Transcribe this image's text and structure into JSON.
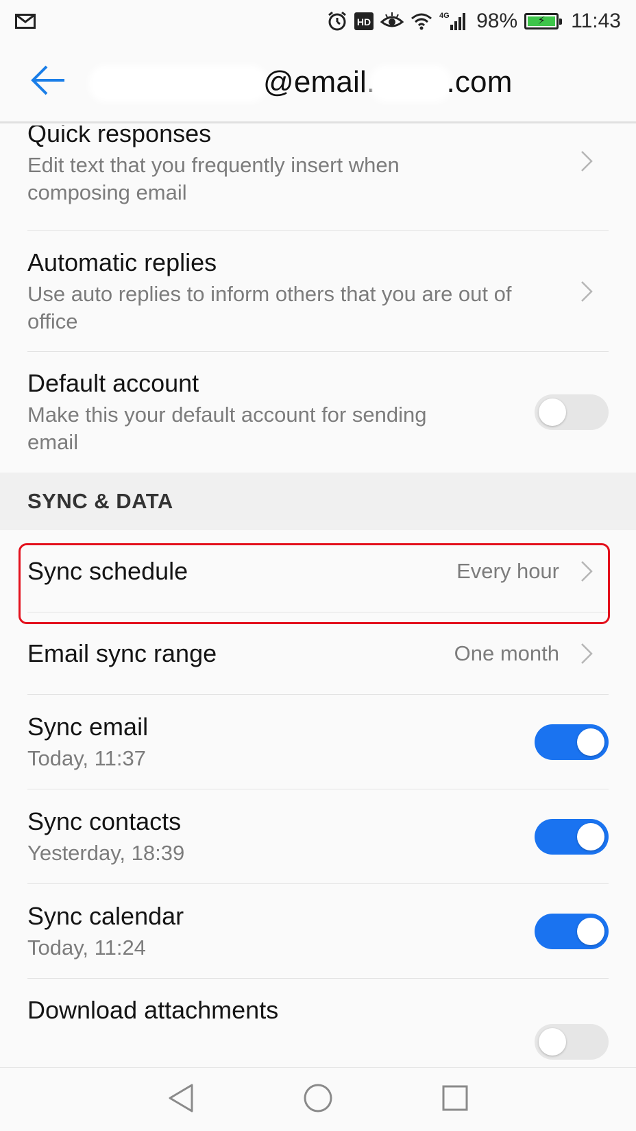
{
  "status_bar": {
    "battery_percent": "98%",
    "network": "4G",
    "time": "11:43"
  },
  "header": {
    "account_suffix": "@email.",
    "account_domain_end": ".com"
  },
  "settings": {
    "quick_responses": {
      "title": "Quick responses",
      "subtitle": "Edit text that you frequently insert when composing email"
    },
    "automatic_replies": {
      "title": "Automatic replies",
      "subtitle": "Use auto replies to inform others that you are out of office"
    },
    "default_account": {
      "title": "Default account",
      "subtitle": "Make this your default account for sending email",
      "enabled": false
    }
  },
  "sync_section": {
    "heading": "SYNC & DATA",
    "sync_schedule": {
      "title": "Sync schedule",
      "value": "Every hour"
    },
    "email_sync_range": {
      "title": "Email sync range",
      "value": "One month"
    },
    "sync_email": {
      "title": "Sync email",
      "subtitle": "Today, 11:37",
      "enabled": true
    },
    "sync_contacts": {
      "title": "Sync contacts",
      "subtitle": "Yesterday, 18:39",
      "enabled": true
    },
    "sync_calendar": {
      "title": "Sync calendar",
      "subtitle": "Today, 11:24",
      "enabled": true
    },
    "download_attachments": {
      "title": "Download attachments",
      "enabled": false
    }
  },
  "colors": {
    "accent": "#1a73f0",
    "back_arrow": "#1a7ee8",
    "highlight": "#e3101c"
  },
  "icons": {
    "status_left": "mail-icon",
    "nav": [
      "back-triangle-icon",
      "home-circle-icon",
      "recents-square-icon"
    ]
  }
}
